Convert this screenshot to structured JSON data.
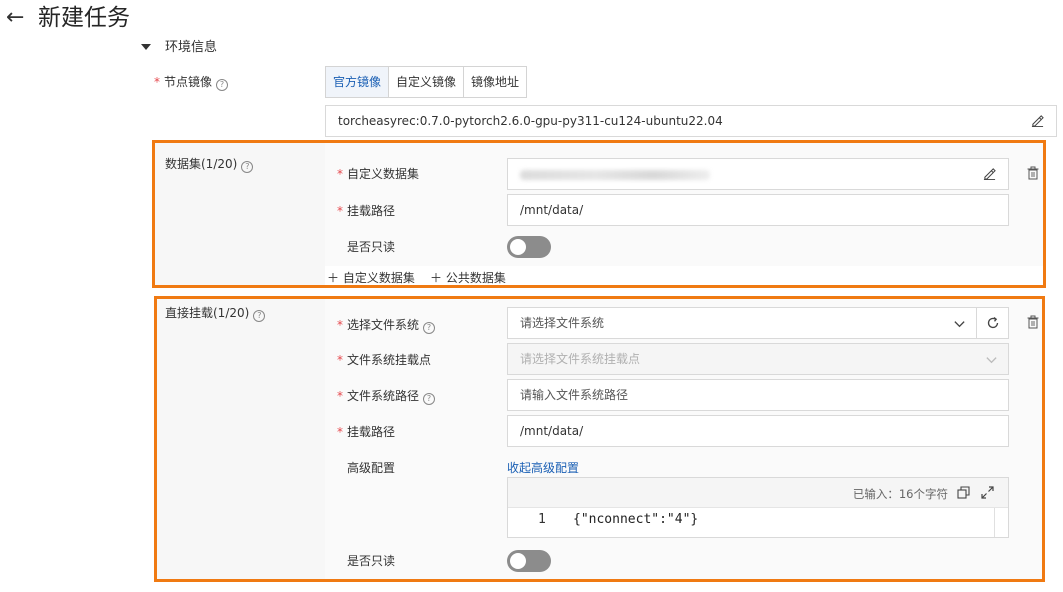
{
  "header": {
    "back_icon": "←",
    "title": "新建任务"
  },
  "env_section": {
    "title": "环境信息"
  },
  "node_image": {
    "required_mark": "*",
    "label": "节点镜像",
    "tabs": [
      {
        "label": "官方镜像",
        "active": true
      },
      {
        "label": "自定义镜像",
        "active": false
      },
      {
        "label": "镜像地址",
        "active": false
      }
    ],
    "value": "torcheasyrec:0.7.0-pytorch2.6.0-gpu-py311-cu124-ubuntu22.04"
  },
  "dataset": {
    "title": "数据集(1/20)",
    "custom_dataset_label": "自定义数据集",
    "mount_path_label": "挂载路径",
    "mount_path_value": "/mnt/data/",
    "readonly_label": "是否只读",
    "readonly_on": false,
    "add_custom_label": "自定义数据集",
    "add_public_label": "公共数据集"
  },
  "direct_mount": {
    "title": "直接挂载(1/20)",
    "fs_label": "选择文件系统",
    "fs_placeholder": "请选择文件系统",
    "mount_point_label": "文件系统挂载点",
    "mount_point_placeholder": "请选择文件系统挂载点",
    "fs_path_label": "文件系统路径",
    "fs_path_placeholder": "请输入文件系统路径",
    "mount_path_label": "挂载路径",
    "mount_path_value": "/mnt/data/",
    "advanced_label": "高级配置",
    "advanced_toggle_link": "收起高级配置",
    "editor_count": "已输入：16个字符",
    "editor_line_no": "1",
    "editor_code": "{\"nconnect\":\"4\"}",
    "readonly_label": "是否只读",
    "readonly_on": false
  },
  "colors": {
    "highlight_border": "#f07a12",
    "link": "#1a5fb4",
    "required": "#e5484d"
  }
}
